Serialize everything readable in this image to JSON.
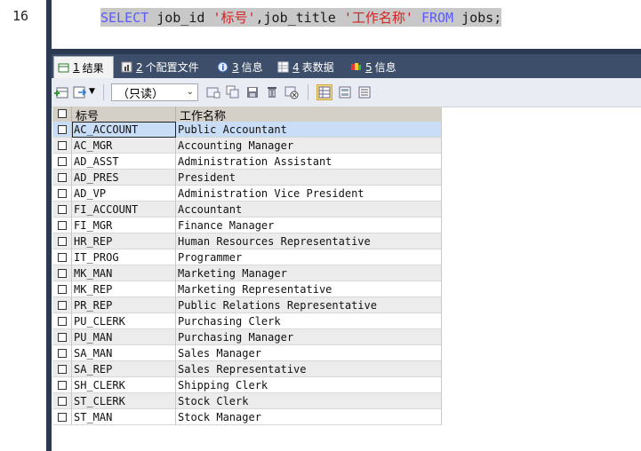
{
  "editor": {
    "line_number": "16",
    "code_select": "SELECT",
    "code_cols": " job_id ",
    "code_alias1": "'标号'",
    "code_mid": ",job_title ",
    "code_alias2": "'工作名称'",
    "code_from": "FROM",
    "code_table": " jobs;"
  },
  "tabs": [
    {
      "num": "1",
      "label": "结果",
      "icon": "grid-result-icon"
    },
    {
      "num": "2",
      "label": "个配置文件",
      "icon": "profile-icon"
    },
    {
      "num": "3",
      "label": "信息",
      "icon": "info-icon"
    },
    {
      "num": "4",
      "label": "表数据",
      "icon": "table-data-icon"
    },
    {
      "num": "5",
      "label": "信息",
      "icon": "info-colored-icon"
    }
  ],
  "toolbar": {
    "mode_select": "（只读）"
  },
  "grid": {
    "headers": [
      "标号",
      "工作名称"
    ],
    "rows": [
      [
        "AC_ACCOUNT",
        "Public Accountant"
      ],
      [
        "AC_MGR",
        "Accounting Manager"
      ],
      [
        "AD_ASST",
        "Administration Assistant"
      ],
      [
        "AD_PRES",
        "President"
      ],
      [
        "AD_VP",
        "Administration Vice President"
      ],
      [
        "FI_ACCOUNT",
        "Accountant"
      ],
      [
        "FI_MGR",
        "Finance Manager"
      ],
      [
        "HR_REP",
        "Human Resources Representative"
      ],
      [
        "IT_PROG",
        "Programmer"
      ],
      [
        "MK_MAN",
        "Marketing Manager"
      ],
      [
        "MK_REP",
        "Marketing Representative"
      ],
      [
        "PR_REP",
        "Public Relations Representative"
      ],
      [
        "PU_CLERK",
        "Purchasing Clerk"
      ],
      [
        "PU_MAN",
        "Purchasing Manager"
      ],
      [
        "SA_MAN",
        "Sales Manager"
      ],
      [
        "SA_REP",
        "Sales Representative"
      ],
      [
        "SH_CLERK",
        "Shipping Clerk"
      ],
      [
        "ST_CLERK",
        "Stock Clerk"
      ],
      [
        "ST_MAN",
        "Stock Manager"
      ]
    ]
  }
}
